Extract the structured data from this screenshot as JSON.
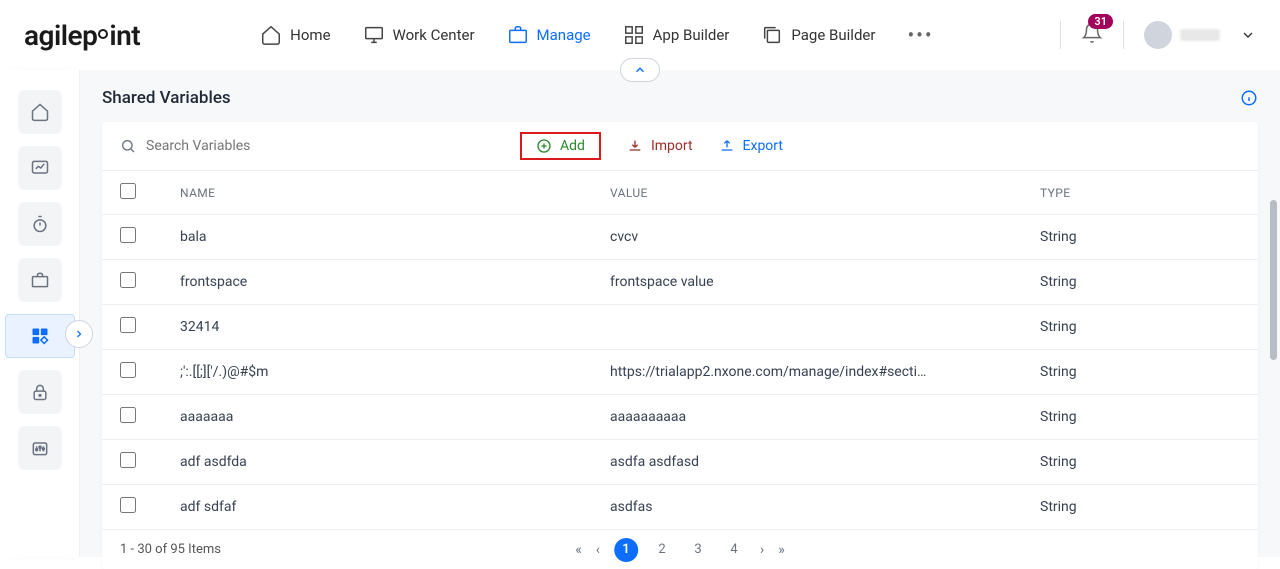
{
  "nav": {
    "home": "Home",
    "work_center": "Work Center",
    "manage": "Manage",
    "app_builder": "App Builder",
    "page_builder": "Page Builder"
  },
  "notification_count": "31",
  "page_title": "Shared Variables",
  "search_placeholder": "Search Variables",
  "actions": {
    "add": "Add",
    "import": "Import",
    "export": "Export"
  },
  "columns": {
    "name": "NAME",
    "value": "VALUE",
    "type": "TYPE"
  },
  "rows": [
    {
      "name": "bala",
      "value": "cvcv",
      "type": "String"
    },
    {
      "name": "frontspace",
      "value": "frontspace value",
      "type": "String"
    },
    {
      "name": "32414",
      "value": "",
      "type": "String"
    },
    {
      "name": ";':.[[;]['/.)@#$m",
      "value": "https://trialapp2.nxone.com/manage/index#secti…",
      "type": "String"
    },
    {
      "name": "aaaaaaa",
      "value": "aaaaaaaaaa",
      "type": "String"
    },
    {
      "name": "adf asdfda",
      "value": "asdfa asdfasd",
      "type": "String"
    },
    {
      "name": "adf sdfaf",
      "value": "asdfas",
      "type": "String"
    }
  ],
  "footer_count": "1 - 30 of 95 Items",
  "pages": [
    "1",
    "2",
    "3",
    "4"
  ],
  "current_page": "1"
}
